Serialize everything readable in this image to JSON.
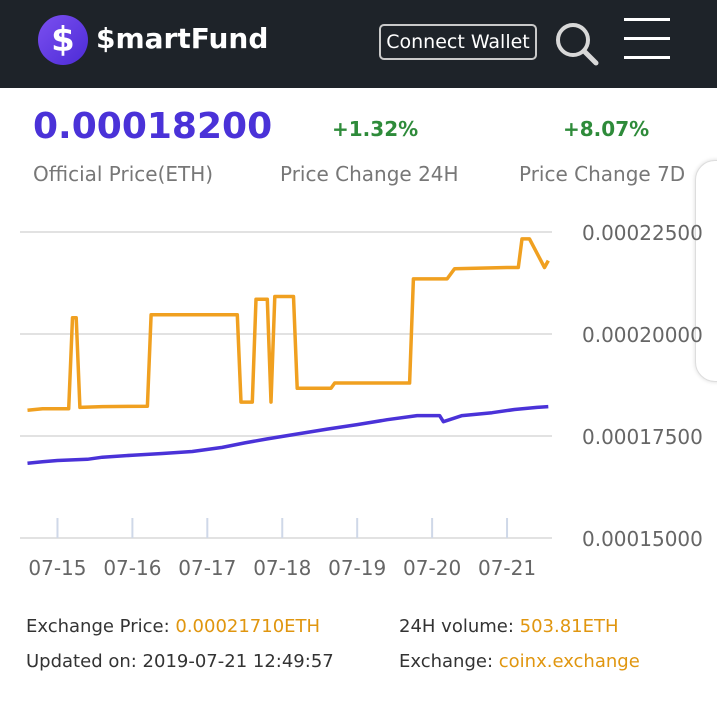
{
  "header": {
    "logo_glyph": "$",
    "brand": "$martFund",
    "connect_label": "Connect Wallet",
    "icons": [
      "search-icon",
      "menu-icon"
    ]
  },
  "stats": {
    "price": "0.00018200",
    "price_label": "Official Price(ETH)",
    "change_24h": "+1.32%",
    "change_24h_label": "Price Change 24H",
    "change_7d": "+8.07%",
    "change_7d_label": "Price Change 7D"
  },
  "colors": {
    "header_bg": "#1e2329",
    "accent_purple": "#4a32d8",
    "positive_green": "#2e8b3a",
    "orange": "#f0a020"
  },
  "chart_data": {
    "type": "line",
    "x_tick_labels": [
      "07-15",
      "07-16",
      "07-17",
      "07-18",
      "07-19",
      "07-20",
      "07-21"
    ],
    "y_tick_labels": [
      "0.00022500",
      "0.00020000",
      "0.00017500",
      "0.00015000"
    ],
    "ylim": [
      0.00015,
      0.000225
    ],
    "xlim": [
      14.5,
      21.6
    ],
    "grid": true,
    "series": [
      {
        "color": "#f0a020",
        "x": [
          14.6,
          14.8,
          15.15,
          15.2,
          15.25,
          15.3,
          15.6,
          16.2,
          16.25,
          17.4,
          17.45,
          17.6,
          17.65,
          17.8,
          17.85,
          17.9,
          17.95,
          18.15,
          18.2,
          18.65,
          18.7,
          19.7,
          19.75,
          20.2,
          20.3,
          21.0,
          21.15,
          21.2,
          21.3,
          21.5,
          21.55
        ],
        "y": [
          0.0001813,
          0.0001817,
          0.0001817,
          0.000204,
          0.000204,
          0.000182,
          0.0001822,
          0.0001823,
          0.0002047,
          0.0002047,
          0.0001833,
          0.0001833,
          0.0002085,
          0.0002085,
          0.0001833,
          0.0002092,
          0.0002092,
          0.0002092,
          0.0001867,
          0.0001867,
          0.000188,
          0.000188,
          0.0002135,
          0.0002135,
          0.000216,
          0.0002163,
          0.0002163,
          0.0002233,
          0.0002233,
          0.0002163,
          0.000218
        ]
      },
      {
        "color": "#4a32d8",
        "x": [
          14.6,
          14.8,
          15.0,
          15.4,
          15.6,
          16.0,
          16.4,
          16.8,
          17.2,
          17.5,
          17.8,
          18.2,
          18.6,
          19.0,
          19.4,
          19.8,
          20.1,
          20.15,
          20.4,
          20.8,
          21.1,
          21.4,
          21.55
        ],
        "y": [
          0.0001683,
          0.0001687,
          0.000169,
          0.0001693,
          0.0001698,
          0.0001703,
          0.0001707,
          0.0001712,
          0.0001722,
          0.0001733,
          0.0001743,
          0.0001755,
          0.0001767,
          0.0001778,
          0.000179,
          0.00018,
          0.00018,
          0.0001785,
          0.00018,
          0.0001807,
          0.0001815,
          0.000182,
          0.0001822
        ]
      }
    ]
  },
  "footer": {
    "exchange_price_label": "Exchange Price: ",
    "exchange_price_value": "0.00021710ETH",
    "volume_label": "24H volume: ",
    "volume_value": "503.81ETH",
    "updated_label": "Updated on: ",
    "updated_value": "2019-07-21 12:49:57",
    "exchange_label": "Exchange: ",
    "exchange_value": "coinx.exchange"
  }
}
